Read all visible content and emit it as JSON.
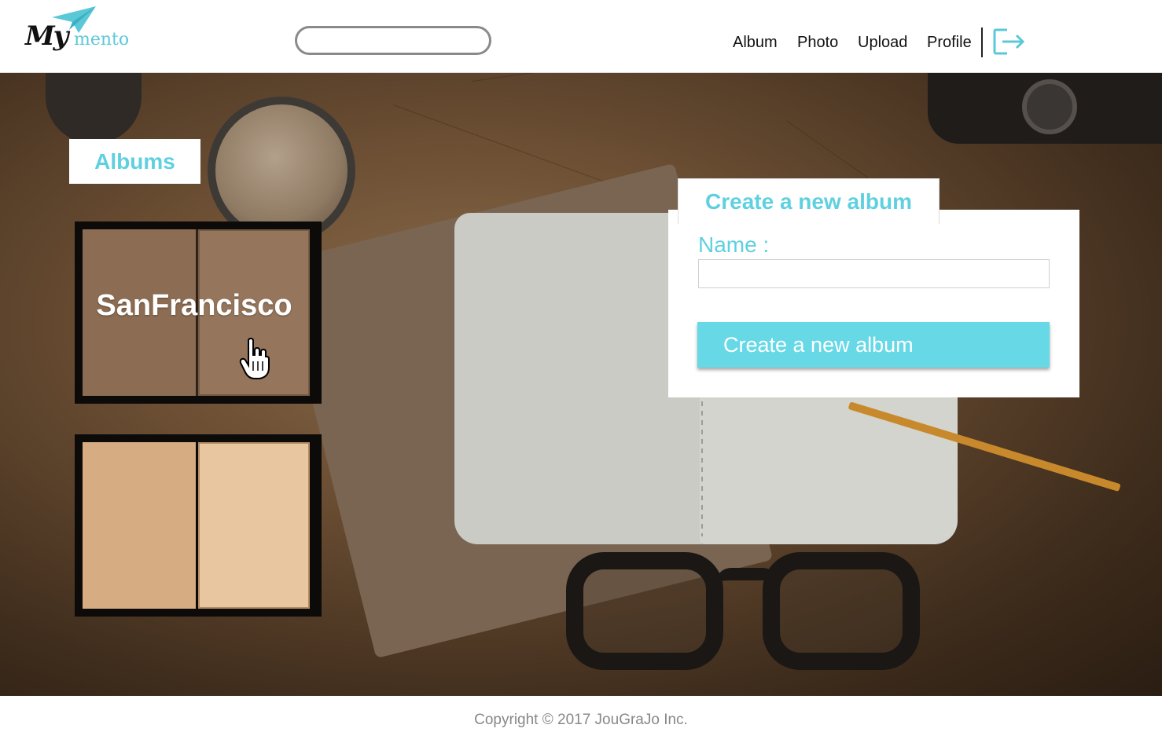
{
  "header": {
    "logo_my": "My",
    "logo_mento": "mento",
    "search_placeholder": "",
    "nav": {
      "album": "Album",
      "photo": "Photo",
      "upload": "Upload",
      "profile": "Profile"
    },
    "logout_icon": "logout-icon"
  },
  "albums": {
    "section_label": "Albums",
    "items": [
      {
        "title": "SanFrancisco"
      },
      {
        "title": ""
      }
    ]
  },
  "create_album": {
    "tab_label": "Create a new album",
    "name_label": "Name :",
    "name_value": "",
    "button_label": "Create a new album"
  },
  "footer": {
    "copyright": "Copyright © 2017 JouGraJo Inc."
  },
  "colors": {
    "accent": "#5fd0e0",
    "button": "#66d8e6",
    "text": "#111111",
    "footer_text": "#888888"
  }
}
